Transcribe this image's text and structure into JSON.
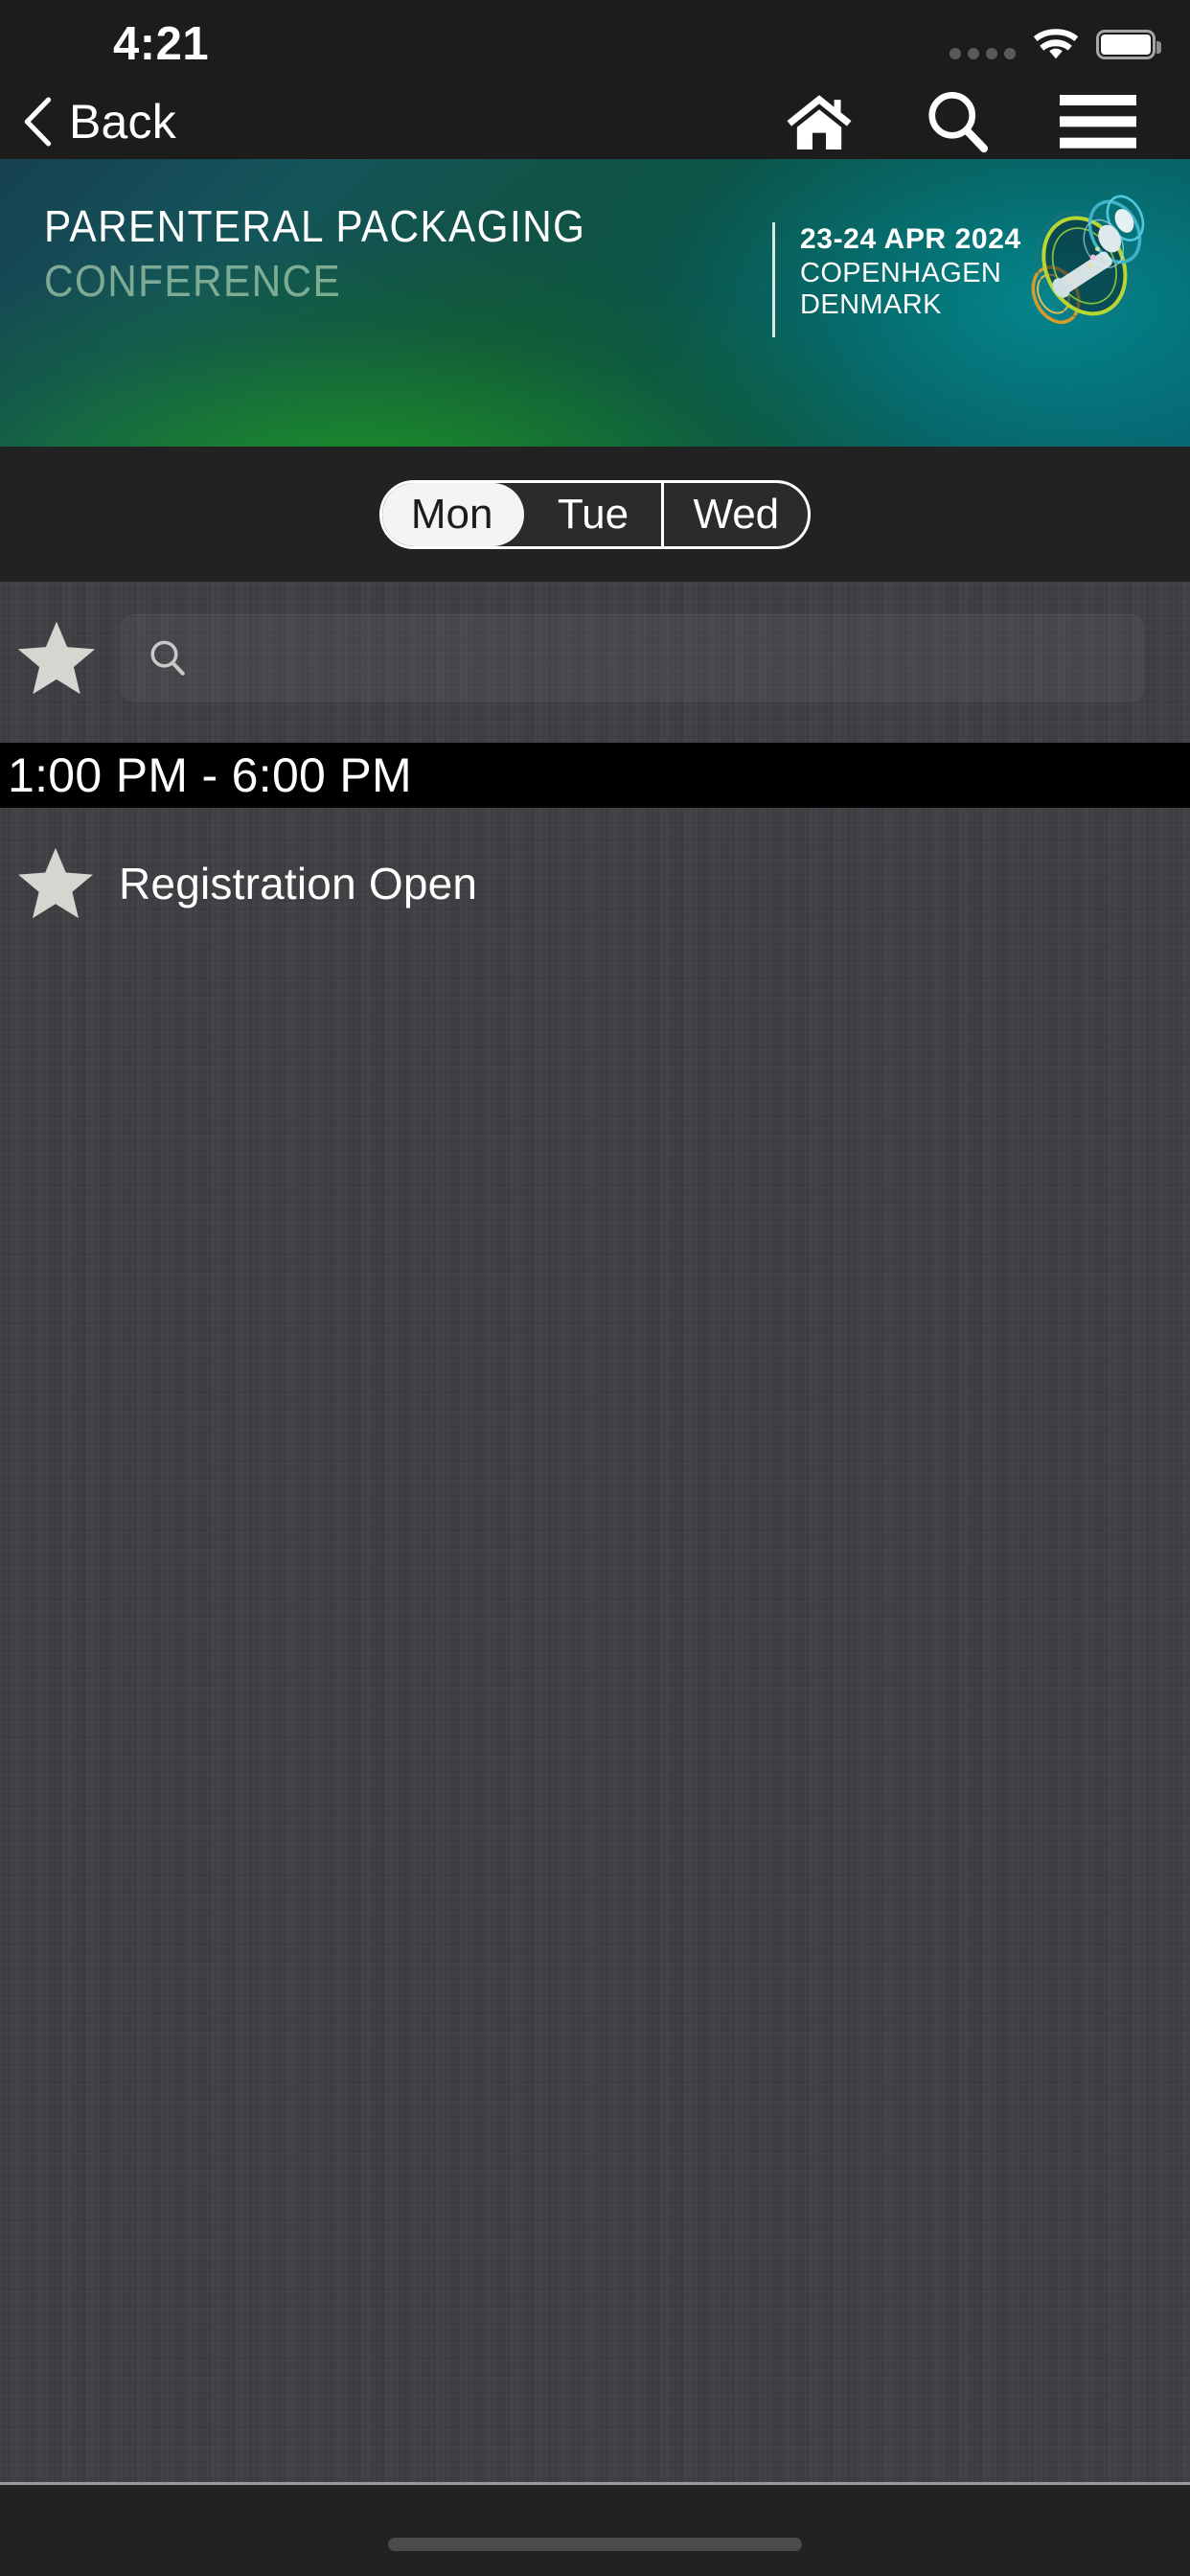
{
  "status_bar": {
    "time": "4:21",
    "signal_icon": "signal-dots-icon",
    "wifi_icon": "wifi-icon",
    "battery_icon": "battery-full-icon"
  },
  "nav_bar": {
    "back_label": "Back",
    "back_icon": "chevron-left-icon",
    "home_icon": "home-icon",
    "search_icon": "search-icon",
    "menu_icon": "hamburger-menu-icon"
  },
  "banner": {
    "title": "PARENTERAL PACKAGING",
    "subtitle": "CONFERENCE",
    "date": "23-24 APR 2024",
    "city": "COPENHAGEN",
    "country": "DENMARK",
    "logo_icon": "conference-rings-logo-icon",
    "colors": {
      "teal": "#14555a",
      "green": "#10523c",
      "cyan": "#0b5a63",
      "title_text": "#ffffff",
      "subtitle_text": "#a8d3a8"
    }
  },
  "day_tabs": {
    "items": [
      {
        "label": "Mon",
        "selected": true
      },
      {
        "label": "Tue",
        "selected": false
      },
      {
        "label": "Wed",
        "selected": false
      }
    ]
  },
  "search": {
    "favorites_icon": "star-filled-icon",
    "magnifier_icon": "search-icon",
    "value": "",
    "placeholder": ""
  },
  "schedule": {
    "time_header": "1:00 PM - 6:00 PM",
    "sessions": [
      {
        "star_icon": "star-filled-icon",
        "title": "Registration Open"
      }
    ]
  },
  "bottom": {
    "home_indicator": "home-indicator"
  }
}
